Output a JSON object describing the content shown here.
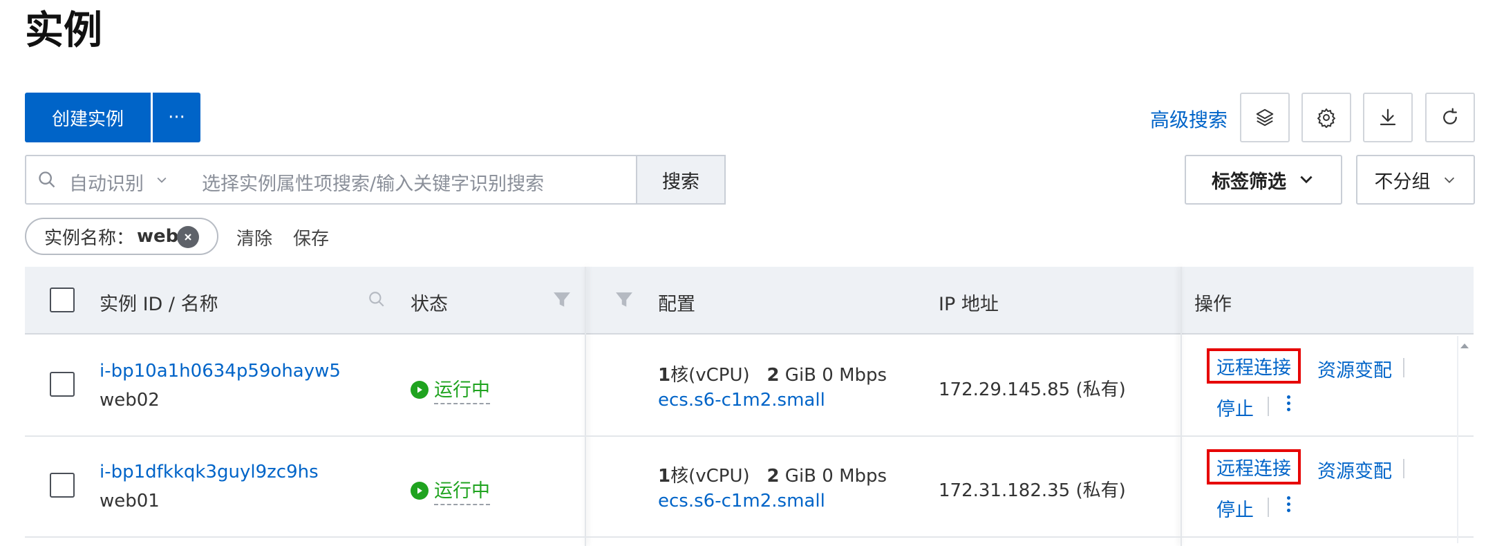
{
  "page": {
    "title": "实例"
  },
  "toolbar": {
    "create_label": "创建实例",
    "more_label": "···",
    "advanced_search": "高级搜索",
    "icons": [
      "layers-icon",
      "gear-icon",
      "download-icon",
      "refresh-icon"
    ]
  },
  "search": {
    "scope": "自动识别",
    "placeholder": "选择实例属性项搜索/输入关键字识别搜索",
    "button": "搜索",
    "tag_filter": "标签筛选",
    "group": "不分组"
  },
  "filters": {
    "chip_label": "实例名称：",
    "chip_value": "web",
    "clear": "清除",
    "save": "保存"
  },
  "table": {
    "headers": {
      "id_name": "实例 ID / 名称",
      "status": "状态",
      "config": "配置",
      "ip": "IP 地址",
      "ops": "操作"
    },
    "rows": [
      {
        "id": "i-bp10a1h0634p59ohayw5",
        "name": "web02",
        "status": "运行中",
        "cores": "1",
        "core_unit": "核(vCPU)",
        "mem": "2",
        "mem_rest": " GiB 0 Mbps",
        "type": "ecs.s6-c1m2.small",
        "ip": "172.29.145.85 (私有)",
        "op_connect": "远程连接",
        "op_resize": "资源变配",
        "op_stop": "停止"
      },
      {
        "id": "i-bp1dfkkqk3guyl9zc9hs",
        "name": "web01",
        "status": "运行中",
        "cores": "1",
        "core_unit": "核(vCPU)",
        "mem": "2",
        "mem_rest": " GiB 0 Mbps",
        "type": "ecs.s6-c1m2.small",
        "ip": "172.31.182.35 (私有)",
        "op_connect": "远程连接",
        "op_resize": "资源变配",
        "op_stop": "停止"
      }
    ]
  },
  "colors": {
    "primary": "#0064c8",
    "running": "#1fa31f",
    "highlight": "#e60000"
  }
}
